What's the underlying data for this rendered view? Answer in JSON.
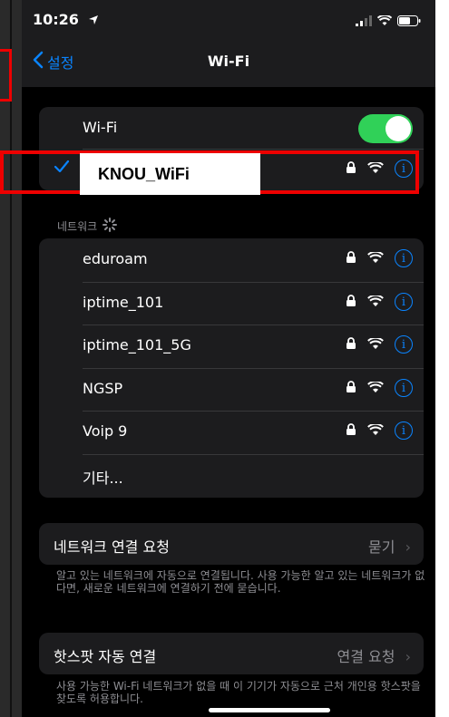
{
  "status_bar": {
    "time": "10:26",
    "location_icon": "location-arrow-icon",
    "signal_icon": "signal-bars-icon",
    "wifi_icon": "wifi-icon",
    "battery_icon": "battery-icon"
  },
  "nav": {
    "back_label": "설정",
    "title": "Wi-Fi"
  },
  "wifi_section": {
    "toggle_label": "Wi-Fi",
    "toggle_on": true,
    "connected_network": "KNOU_WiFi"
  },
  "networks_header": "네트워크",
  "networks": [
    {
      "name": "eduroam",
      "locked": true
    },
    {
      "name": "iptime_101",
      "locked": true
    },
    {
      "name": "iptime_101_5G",
      "locked": true
    },
    {
      "name": "NGSP",
      "locked": true
    },
    {
      "name": "Voip 9",
      "locked": true
    }
  ],
  "other_label": "기타...",
  "ask_to_join": {
    "label": "네트워크 연결 요청",
    "value": "묻기",
    "description": "알고 있는 네트워크에 자동으로 연결됩니다. 사용 가능한 알고 있는 네트워크가 없다면, 새로운 네트워크에 연결하기 전에 묻습니다."
  },
  "hotspot": {
    "label": "핫스팟 자동 연결",
    "value": "연결 요청",
    "description": "사용 가능한 Wi-Fi 네트워크가 없을 때 이 기기가 자동으로 근처 개인용 핫스팟을 찾도록 허용합니다."
  },
  "colors": {
    "accent": "#0a84ff",
    "toggle_on": "#30d158",
    "highlight": "#ee0000"
  }
}
